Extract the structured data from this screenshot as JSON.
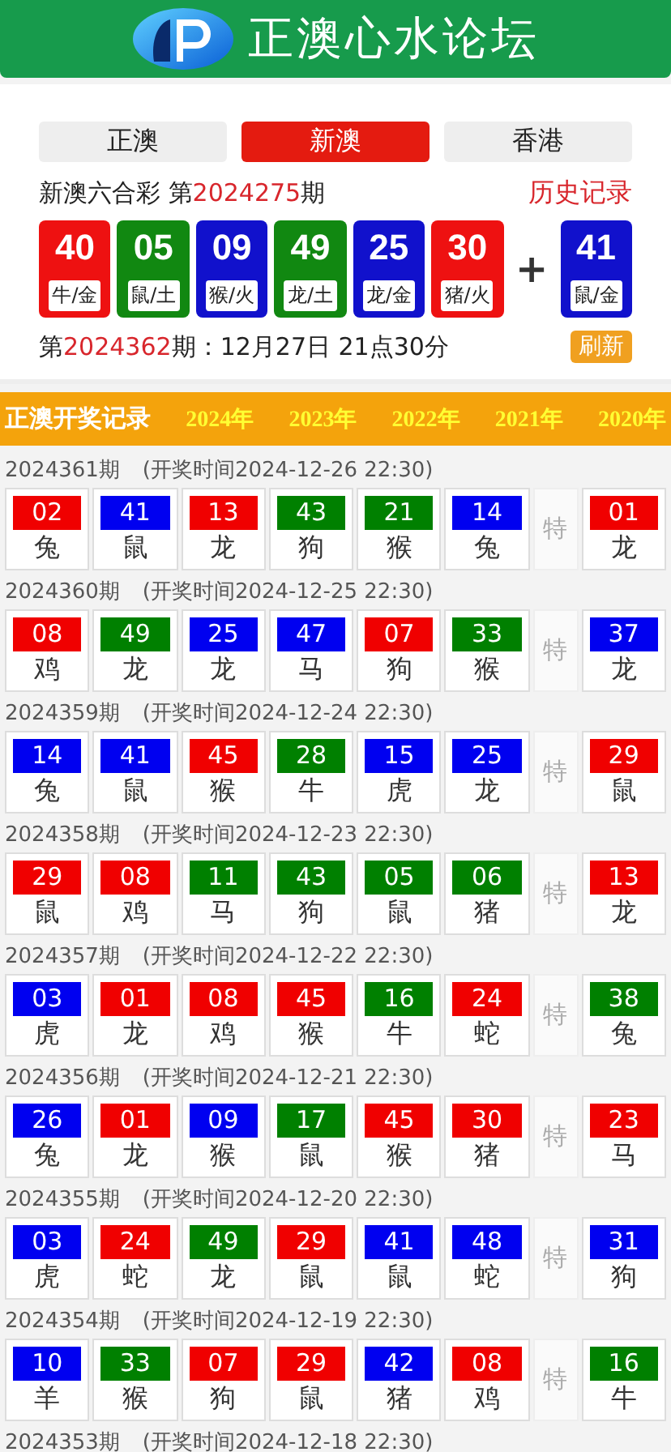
{
  "header": {
    "title": "正澳心水论坛"
  },
  "tabs": [
    {
      "label": "正澳",
      "selected": false
    },
    {
      "label": "新澳",
      "selected": true
    },
    {
      "label": "香港",
      "selected": false
    }
  ],
  "draw": {
    "name": "新澳六合彩 第",
    "issue": "2024275",
    "issue_suffix": "期",
    "history_link": "历史记录",
    "balls": [
      {
        "number": "40",
        "zodiac": "牛/金",
        "color": "#ee1111"
      },
      {
        "number": "05",
        "zodiac": "鼠/土",
        "color": "#118811"
      },
      {
        "number": "09",
        "zodiac": "猴/火",
        "color": "#1111cc"
      },
      {
        "number": "49",
        "zodiac": "龙/土",
        "color": "#118811"
      },
      {
        "number": "25",
        "zodiac": "龙/金",
        "color": "#1111cc"
      },
      {
        "number": "30",
        "zodiac": "猪/火",
        "color": "#ee1111"
      }
    ],
    "plus": "+",
    "special": {
      "number": "41",
      "zodiac": "鼠/金",
      "color": "#1111cc"
    },
    "next_prefix": "第",
    "next_issue": "2024362",
    "next_time": "期：12月27日 21点30分",
    "refresh": "刷新"
  },
  "records": {
    "title": "正澳开奖记录",
    "years": [
      "2024年",
      "2023年",
      "2022年",
      "2021年",
      "2020年"
    ],
    "rows": [
      {
        "issue": "2024361期",
        "time": "(开奖时间2024-12-26 22:30)",
        "balls": [
          {
            "number": "02",
            "zodiac": "兔",
            "color": "#f00000"
          },
          {
            "number": "41",
            "zodiac": "鼠",
            "color": "#0000f0"
          },
          {
            "number": "13",
            "zodiac": "龙",
            "color": "#f00000"
          },
          {
            "number": "43",
            "zodiac": "狗",
            "color": "#008000"
          },
          {
            "number": "21",
            "zodiac": "猴",
            "color": "#008000"
          },
          {
            "number": "14",
            "zodiac": "兔",
            "color": "#0000f0"
          }
        ],
        "special_label": "特",
        "special": {
          "number": "01",
          "zodiac": "龙",
          "color": "#f00000"
        }
      },
      {
        "issue": "2024360期",
        "time": "(开奖时间2024-12-25 22:30)",
        "balls": [
          {
            "number": "08",
            "zodiac": "鸡",
            "color": "#f00000"
          },
          {
            "number": "49",
            "zodiac": "龙",
            "color": "#008000"
          },
          {
            "number": "25",
            "zodiac": "龙",
            "color": "#0000f0"
          },
          {
            "number": "47",
            "zodiac": "马",
            "color": "#0000f0"
          },
          {
            "number": "07",
            "zodiac": "狗",
            "color": "#f00000"
          },
          {
            "number": "33",
            "zodiac": "猴",
            "color": "#008000"
          }
        ],
        "special_label": "特",
        "special": {
          "number": "37",
          "zodiac": "龙",
          "color": "#0000f0"
        }
      },
      {
        "issue": "2024359期",
        "time": "(开奖时间2024-12-24 22:30)",
        "balls": [
          {
            "number": "14",
            "zodiac": "兔",
            "color": "#0000f0"
          },
          {
            "number": "41",
            "zodiac": "鼠",
            "color": "#0000f0"
          },
          {
            "number": "45",
            "zodiac": "猴",
            "color": "#f00000"
          },
          {
            "number": "28",
            "zodiac": "牛",
            "color": "#008000"
          },
          {
            "number": "15",
            "zodiac": "虎",
            "color": "#0000f0"
          },
          {
            "number": "25",
            "zodiac": "龙",
            "color": "#0000f0"
          }
        ],
        "special_label": "特",
        "special": {
          "number": "29",
          "zodiac": "鼠",
          "color": "#f00000"
        }
      },
      {
        "issue": "2024358期",
        "time": "(开奖时间2024-12-23 22:30)",
        "balls": [
          {
            "number": "29",
            "zodiac": "鼠",
            "color": "#f00000"
          },
          {
            "number": "08",
            "zodiac": "鸡",
            "color": "#f00000"
          },
          {
            "number": "11",
            "zodiac": "马",
            "color": "#008000"
          },
          {
            "number": "43",
            "zodiac": "狗",
            "color": "#008000"
          },
          {
            "number": "05",
            "zodiac": "鼠",
            "color": "#008000"
          },
          {
            "number": "06",
            "zodiac": "猪",
            "color": "#008000"
          }
        ],
        "special_label": "特",
        "special": {
          "number": "13",
          "zodiac": "龙",
          "color": "#f00000"
        }
      },
      {
        "issue": "2024357期",
        "time": "(开奖时间2024-12-22 22:30)",
        "balls": [
          {
            "number": "03",
            "zodiac": "虎",
            "color": "#0000f0"
          },
          {
            "number": "01",
            "zodiac": "龙",
            "color": "#f00000"
          },
          {
            "number": "08",
            "zodiac": "鸡",
            "color": "#f00000"
          },
          {
            "number": "45",
            "zodiac": "猴",
            "color": "#f00000"
          },
          {
            "number": "16",
            "zodiac": "牛",
            "color": "#008000"
          },
          {
            "number": "24",
            "zodiac": "蛇",
            "color": "#f00000"
          }
        ],
        "special_label": "特",
        "special": {
          "number": "38",
          "zodiac": "兔",
          "color": "#008000"
        }
      },
      {
        "issue": "2024356期",
        "time": "(开奖时间2024-12-21 22:30)",
        "balls": [
          {
            "number": "26",
            "zodiac": "兔",
            "color": "#0000f0"
          },
          {
            "number": "01",
            "zodiac": "龙",
            "color": "#f00000"
          },
          {
            "number": "09",
            "zodiac": "猴",
            "color": "#0000f0"
          },
          {
            "number": "17",
            "zodiac": "鼠",
            "color": "#008000"
          },
          {
            "number": "45",
            "zodiac": "猴",
            "color": "#f00000"
          },
          {
            "number": "30",
            "zodiac": "猪",
            "color": "#f00000"
          }
        ],
        "special_label": "特",
        "special": {
          "number": "23",
          "zodiac": "马",
          "color": "#f00000"
        }
      },
      {
        "issue": "2024355期",
        "time": "(开奖时间2024-12-20 22:30)",
        "balls": [
          {
            "number": "03",
            "zodiac": "虎",
            "color": "#0000f0"
          },
          {
            "number": "24",
            "zodiac": "蛇",
            "color": "#f00000"
          },
          {
            "number": "49",
            "zodiac": "龙",
            "color": "#008000"
          },
          {
            "number": "29",
            "zodiac": "鼠",
            "color": "#f00000"
          },
          {
            "number": "41",
            "zodiac": "鼠",
            "color": "#0000f0"
          },
          {
            "number": "48",
            "zodiac": "蛇",
            "color": "#0000f0"
          }
        ],
        "special_label": "特",
        "special": {
          "number": "31",
          "zodiac": "狗",
          "color": "#0000f0"
        }
      },
      {
        "issue": "2024354期",
        "time": "(开奖时间2024-12-19 22:30)",
        "balls": [
          {
            "number": "10",
            "zodiac": "羊",
            "color": "#0000f0"
          },
          {
            "number": "33",
            "zodiac": "猴",
            "color": "#008000"
          },
          {
            "number": "07",
            "zodiac": "狗",
            "color": "#f00000"
          },
          {
            "number": "29",
            "zodiac": "鼠",
            "color": "#f00000"
          },
          {
            "number": "42",
            "zodiac": "猪",
            "color": "#0000f0"
          },
          {
            "number": "08",
            "zodiac": "鸡",
            "color": "#f00000"
          }
        ],
        "special_label": "特",
        "special": {
          "number": "16",
          "zodiac": "牛",
          "color": "#008000"
        }
      },
      {
        "issue": "2024353期",
        "time": "(开奖时间2024-12-18 22:30)"
      }
    ]
  }
}
